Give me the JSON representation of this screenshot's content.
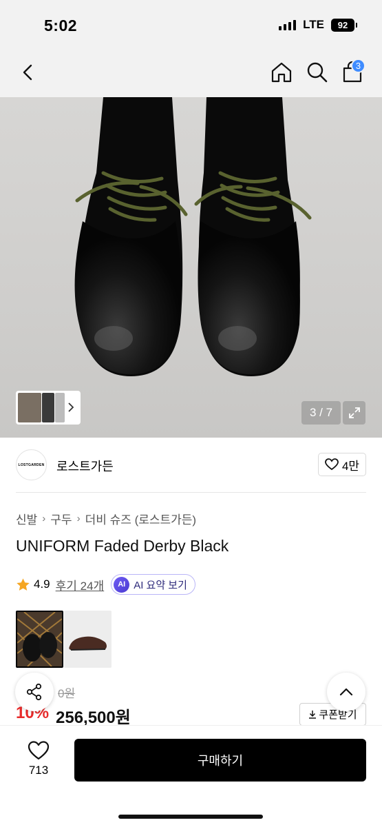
{
  "status_bar": {
    "time": "5:02",
    "network": "LTE",
    "battery": "92"
  },
  "nav": {
    "cart_count": "3"
  },
  "gallery": {
    "counter": "3 / 7"
  },
  "brand": {
    "logo_text": "LOSTGARDEN",
    "name": "로스트가든",
    "likes": "4만"
  },
  "breadcrumb": [
    "신발",
    "구두",
    "더비 슈즈 (로스트가든)"
  ],
  "product": {
    "title": "UNIFORM Faded Derby Black",
    "rating": "4.9",
    "reviews": "후기 24개",
    "ai_badge": "AI",
    "ai_summary": "AI 요약 보기",
    "original_price": "0원",
    "discount": "10%",
    "price": "256,500원"
  },
  "actions": {
    "coupon": "쿠폰받기",
    "wish_count": "713",
    "buy": "구매하기"
  },
  "colors": {
    "accent": "#3f8cff",
    "discount": "#e82b2b",
    "ai": "#5b4be3",
    "star": "#f5a623"
  }
}
